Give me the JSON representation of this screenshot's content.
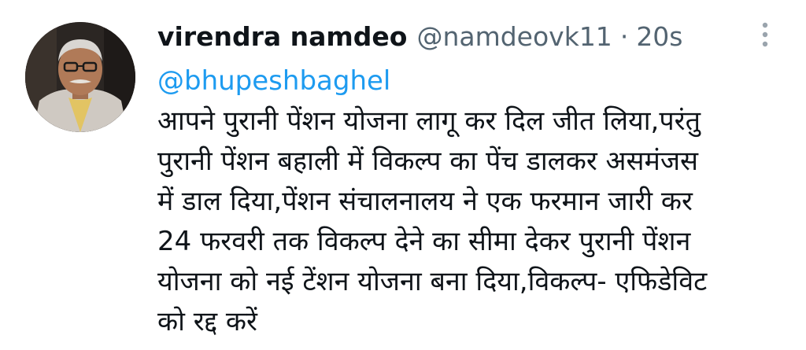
{
  "tweet": {
    "author": {
      "display_name": "virendra namdeo",
      "handle": "@namdeovk11"
    },
    "separator": "·",
    "timestamp": "20s",
    "more_icon": "more-vertical-icon",
    "mention": "@bhupeshbaghel",
    "text": "आपने पुरानी पेंशन योजना लागू कर दिल जीत लिया,परंतु\nपुरानी पेंशन बहाली में विकल्प का पेंच डालकर असमंजस\nमें डाल दिया,पेंशन संचालनालय ने एक फरमान जारी कर\n24 फरवरी तक विकल्प देने का सीमा देकर पुरानी पेंशन\nयोजना को नई टेंशन योजना बना दिया,विकल्प- एफिडेविट\nको रद्द करें"
  },
  "colors": {
    "text_primary": "#0f1419",
    "text_secondary": "#536471",
    "link": "#1d9bf0",
    "background": "#ffffff"
  }
}
